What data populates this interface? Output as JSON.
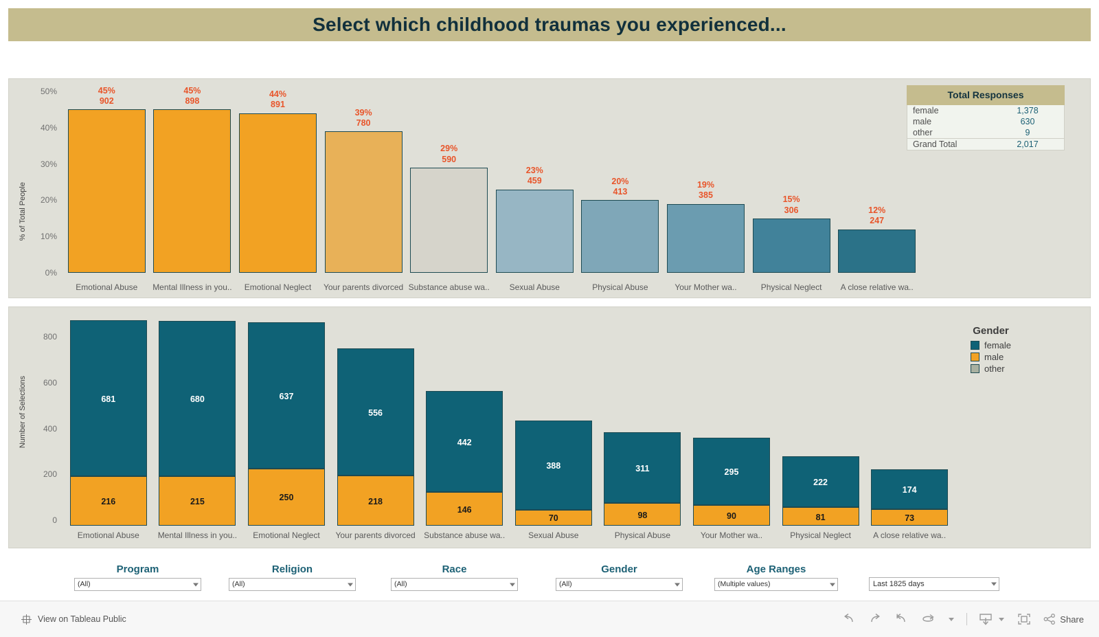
{
  "header": {
    "title": "Select which childhood traumas you experienced..."
  },
  "total_responses": {
    "title": "Total Responses",
    "rows": [
      {
        "label": "female",
        "value": "1,378"
      },
      {
        "label": "male",
        "value": "630"
      },
      {
        "label": "other",
        "value": "9"
      },
      {
        "label": "Grand Total",
        "value": "2,017"
      }
    ]
  },
  "legend": {
    "title": "Gender",
    "items": [
      {
        "label": "female",
        "color": "#0f6276"
      },
      {
        "label": "male",
        "color": "#f2a223"
      },
      {
        "label": "other",
        "color": "#a8b0a0"
      }
    ]
  },
  "filters": [
    {
      "title": "Program",
      "value": "(All)"
    },
    {
      "title": "Religion",
      "value": "(All)"
    },
    {
      "title": "Race",
      "value": "(All)"
    },
    {
      "title": "Gender",
      "value": "(All)"
    },
    {
      "title": "Age Ranges",
      "value": "(Multiple values)"
    }
  ],
  "date_filter": {
    "value": "Last 1825 days"
  },
  "toolbar": {
    "view_label": "View on Tableau Public",
    "share_label": "Share",
    "icons": [
      "undo-icon",
      "redo-icon",
      "revert-icon",
      "refresh-icon",
      "caret-down-icon",
      "download-icon",
      "fullscreen-icon",
      "share-icon"
    ]
  },
  "chart_data": [
    {
      "type": "bar",
      "title": "",
      "xlabel": "",
      "ylabel": "% of Total People",
      "ylim": [
        0,
        50
      ],
      "yticks": [
        "0%",
        "10%",
        "20%",
        "30%",
        "40%",
        "50%"
      ],
      "grid": false,
      "categories": [
        "Emotional Abuse",
        "Mental Illness in you..",
        "Emotional Neglect",
        "Your parents divorced",
        "Substance abuse wa..",
        "Sexual Abuse",
        "Physical Abuse",
        "Your Mother wa..",
        "Physical Neglect",
        "A close relative wa.."
      ],
      "percent_labels": [
        "45%",
        "45%",
        "44%",
        "39%",
        "29%",
        "23%",
        "20%",
        "19%",
        "15%",
        "12%"
      ],
      "values": [
        902,
        898,
        891,
        780,
        590,
        459,
        413,
        385,
        306,
        247
      ],
      "percents": [
        45,
        45,
        44,
        39,
        29,
        23,
        20,
        19,
        15,
        12
      ],
      "colors": [
        "#f2a223",
        "#f2a223",
        "#f2a223",
        "#e8b158",
        "#d6d4cb",
        "#97b6c4",
        "#7fa7b8",
        "#6b9cb0",
        "#41829a",
        "#2b7288"
      ]
    },
    {
      "type": "bar",
      "stacked": true,
      "title": "",
      "xlabel": "",
      "ylabel": "Number of Selections",
      "ylim": [
        0,
        900
      ],
      "yticks": [
        "0",
        "200",
        "400",
        "600",
        "800"
      ],
      "grid": false,
      "categories": [
        "Emotional Abuse",
        "Mental Illness in you..",
        "Emotional Neglect",
        "Your parents divorced",
        "Substance abuse wa..",
        "Sexual Abuse",
        "Physical Abuse",
        "Your Mother wa..",
        "Physical Neglect",
        "A close relative wa.."
      ],
      "series": [
        {
          "name": "male",
          "color": "#f2a223",
          "values": [
            216,
            215,
            250,
            218,
            146,
            70,
            98,
            90,
            81,
            73
          ]
        },
        {
          "name": "female",
          "color": "#0f6276",
          "values": [
            681,
            680,
            637,
            556,
            442,
            388,
            311,
            295,
            222,
            174
          ]
        }
      ]
    }
  ]
}
